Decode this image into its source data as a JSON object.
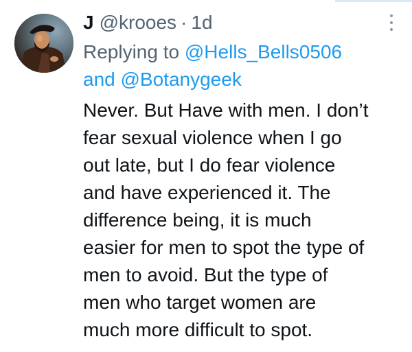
{
  "tweet": {
    "author": {
      "display_name": "J",
      "handle": "@krooes",
      "avatar_icon": "portrait-avatar"
    },
    "separator": "·",
    "time": "1d",
    "more_icon": "more-vertical-icon",
    "reply": {
      "prefix": "Replying to",
      "first_user": "@Hells_Bells0506",
      "conjunction": "and",
      "second_user": "@Botanygeek"
    },
    "text": "Never. But Have with men. I don’t\nfear sexual violence when I go\nout late, but I do fear violence\nand have experienced it. The\ndifference being, it is much\neasier for men to spot the type of\nmen to avoid. But the type of\nmen who target women are\nmuch more difficult to spot."
  },
  "colors": {
    "text": "#0f1419",
    "muted": "#536471",
    "link": "#1d9bf0",
    "icon": "#8b98a5"
  }
}
